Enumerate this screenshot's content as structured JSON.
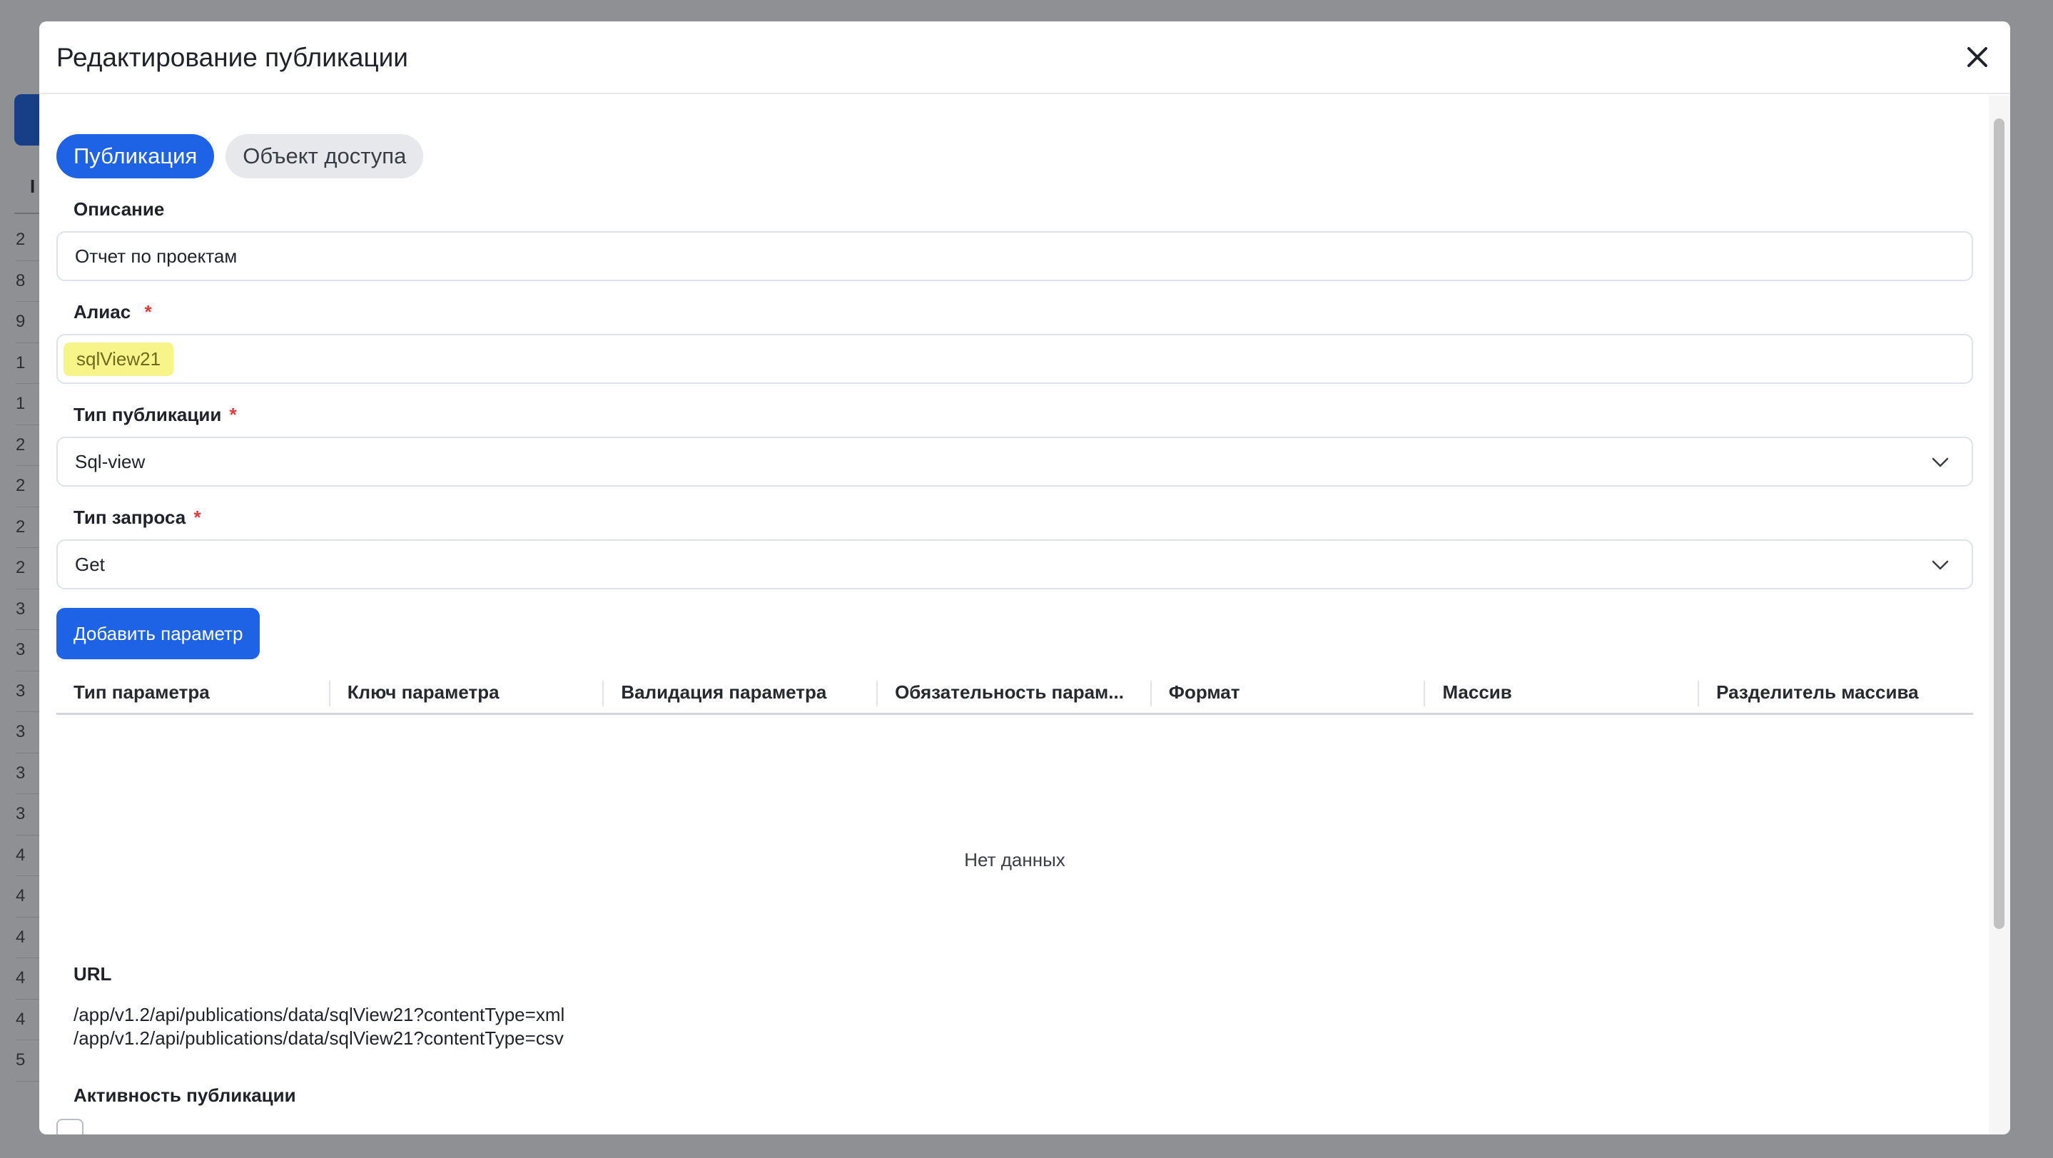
{
  "background": {
    "row_digits": [
      "2",
      "8",
      "9",
      "1",
      "1",
      "2",
      "2",
      "2",
      "2",
      "3",
      "3",
      "3",
      "3",
      "3",
      "3",
      "4",
      "4",
      "4",
      "4",
      "4",
      "5"
    ],
    "header_char": "I"
  },
  "modal": {
    "title": "Редактирование публикации",
    "tabs": [
      {
        "label": "Публикация",
        "active": true
      },
      {
        "label": "Объект доступа",
        "active": false
      }
    ],
    "description": {
      "label": "Описание",
      "value": "Отчет по проектам"
    },
    "alias": {
      "label": "Алиас",
      "required_mark": "*",
      "value": "sqlView21"
    },
    "publication_type": {
      "label": "Тип публикации",
      "required_mark": "*",
      "value": "Sql-view"
    },
    "request_type": {
      "label": "Тип запроса",
      "required_mark": "*",
      "value": "Get"
    },
    "add_param_button": "Добавить параметр",
    "params_table": {
      "columns": [
        "Тип параметра",
        "Ключ параметра",
        "Валидация параметра",
        "Обязательность парам...",
        "Формат",
        "Массив",
        "Разделитель массива"
      ],
      "empty_text": "Нет данных"
    },
    "url": {
      "label": "URL",
      "links": [
        "/app/v1.2/api/publications/data/sqlView21?contentType=xml",
        "/app/v1.2/api/publications/data/sqlView21?contentType=csv"
      ]
    },
    "activity": {
      "label": "Активность публикации",
      "checked": false
    }
  },
  "colors": {
    "accent": "#1e63e6",
    "highlight": "#f7f58a",
    "required": "#e23b3b"
  }
}
